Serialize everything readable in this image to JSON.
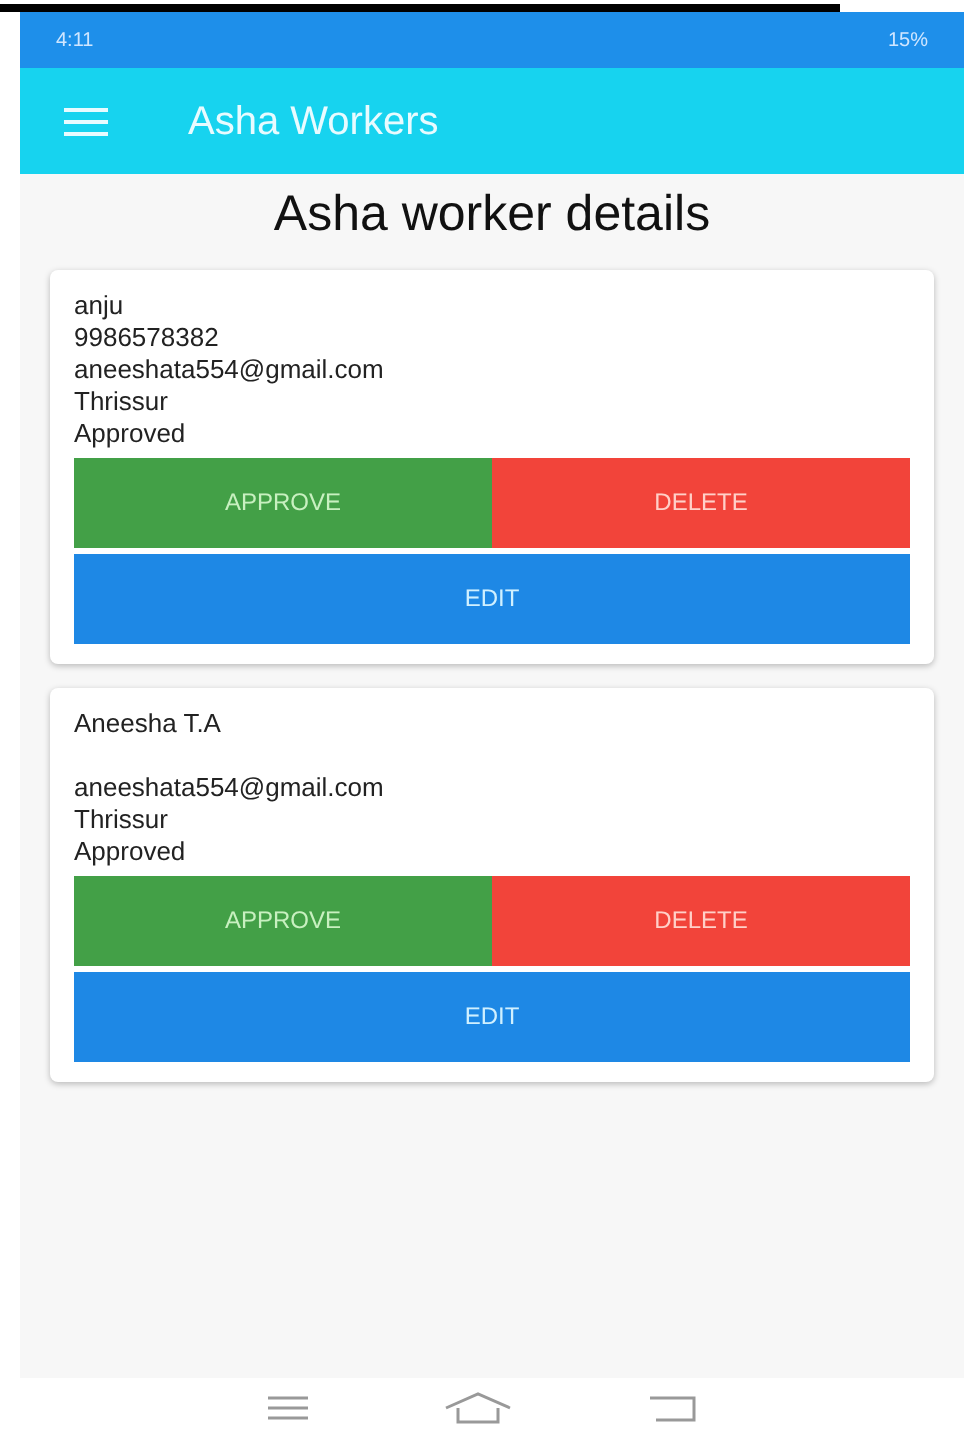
{
  "status_bar": {
    "time": "4:11",
    "battery": "15%"
  },
  "app_bar": {
    "title": "Asha Workers"
  },
  "heading": "Asha worker details",
  "workers": [
    {
      "name": "anju",
      "phone": "9986578382",
      "email": "aneeshata554@gmail.com",
      "place": "Thrissur",
      "status": "Approved",
      "buttons": {
        "approve": "APPROVE",
        "delete": "DELETE",
        "edit": "EDIT"
      }
    },
    {
      "name": "Aneesha T.A",
      "email": "aneeshata554@gmail.com",
      "place": "Thrissur",
      "status": "Approved",
      "buttons": {
        "approve": "APPROVE",
        "delete": "DELETE",
        "edit": "EDIT"
      }
    }
  ]
}
